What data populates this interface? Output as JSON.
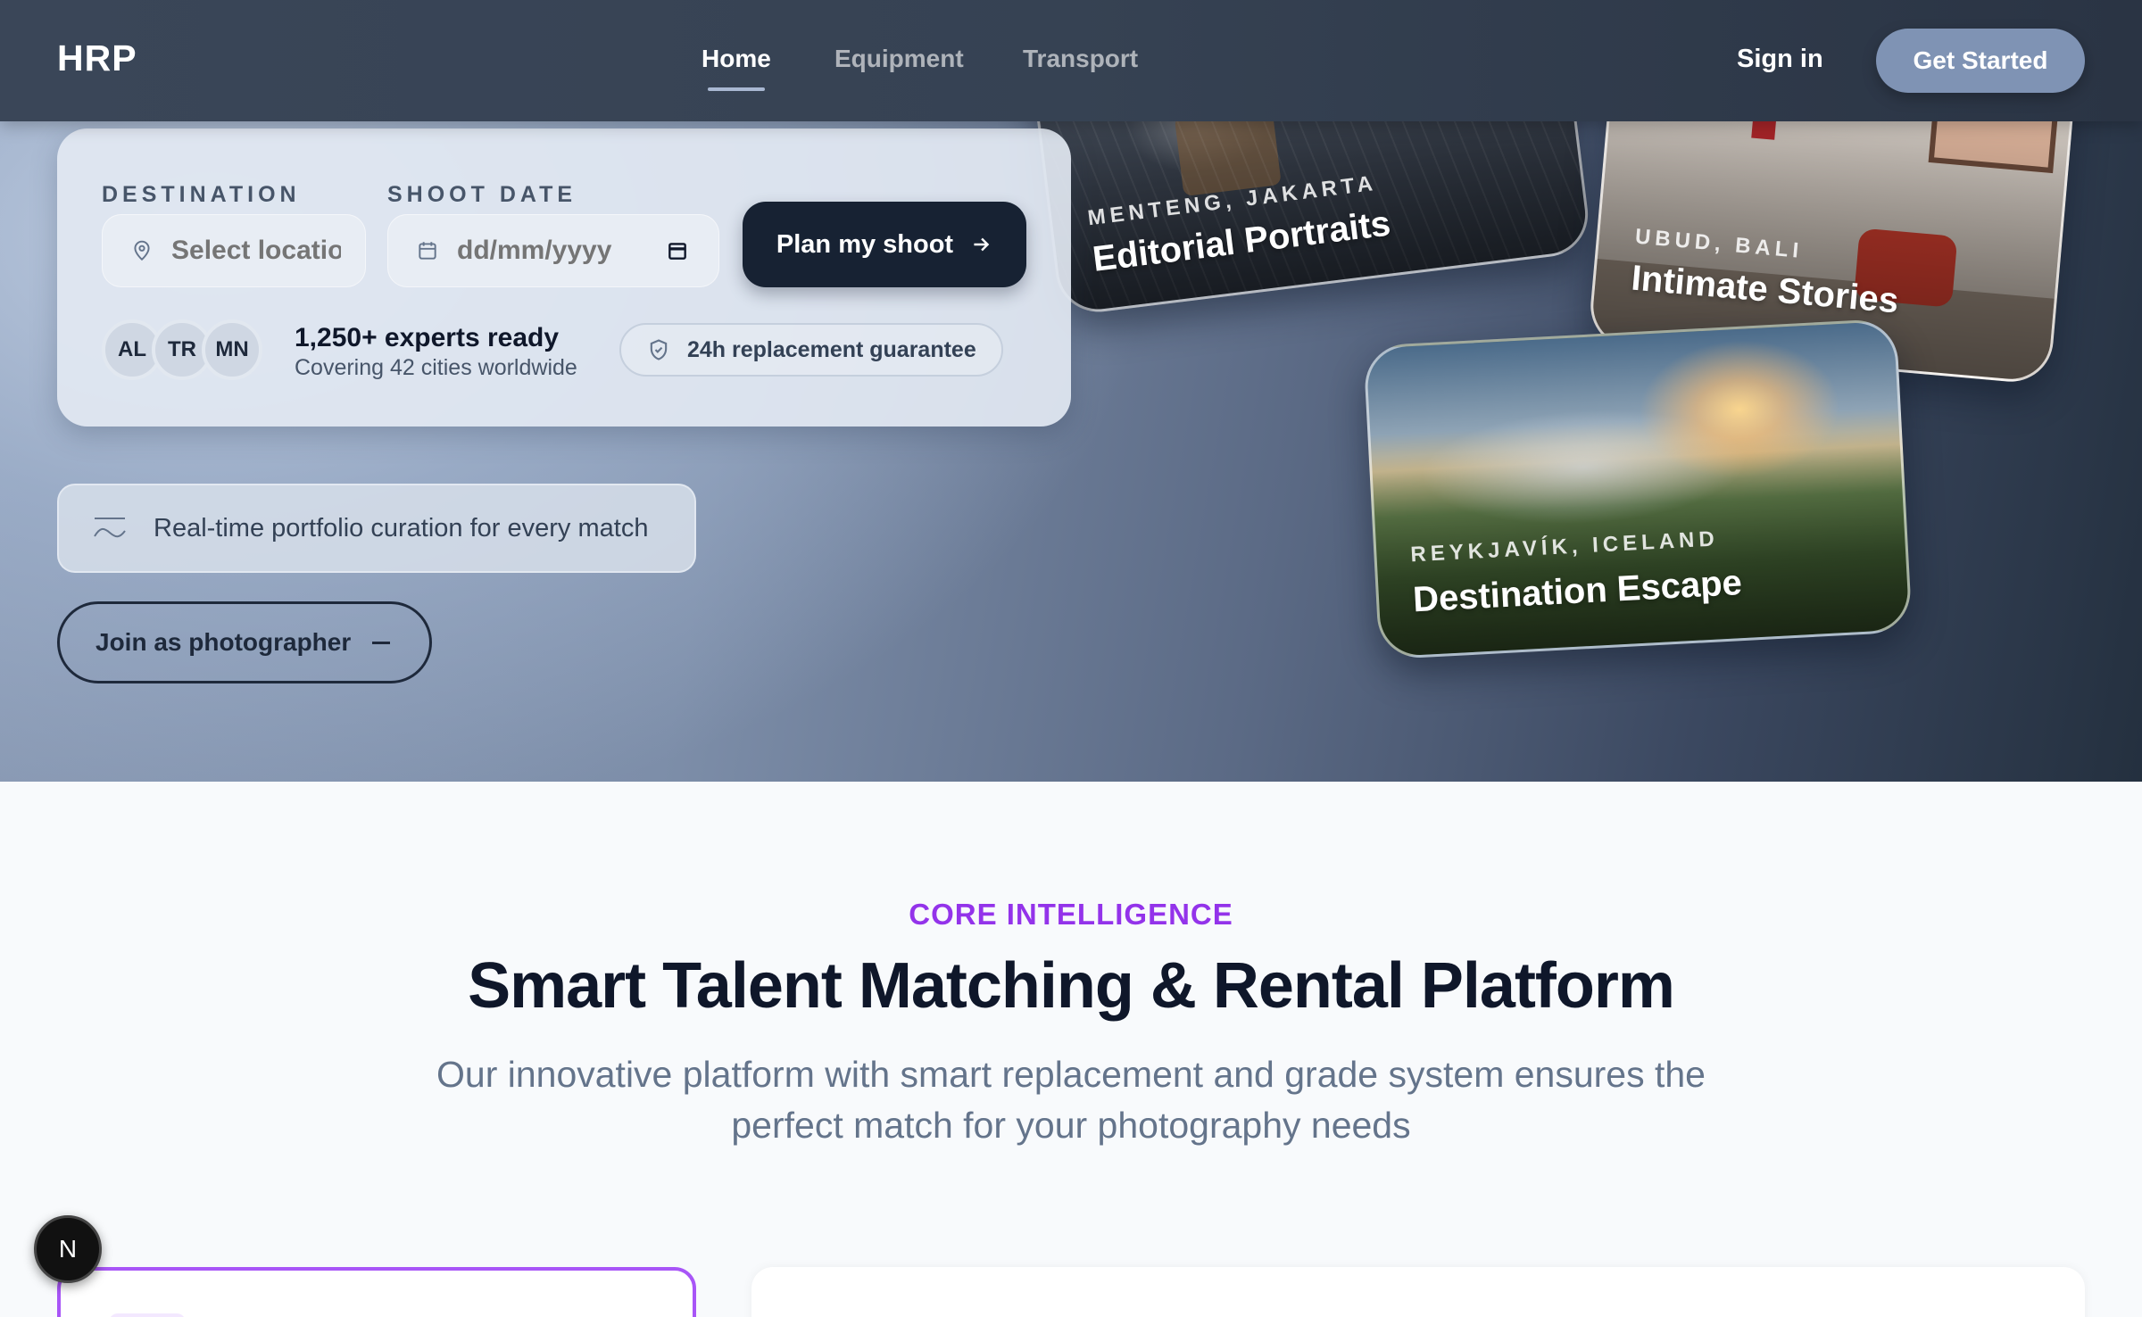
{
  "nav": {
    "brand": "HRP",
    "links": [
      "Home",
      "Equipment",
      "Transport"
    ],
    "active_link": "Home",
    "sign_in": "Sign in",
    "get_started": "Get Started"
  },
  "search": {
    "destination_label": "DESTINATION",
    "destination_placeholder": "Select location",
    "date_label": "SHOOT DATE",
    "date_placeholder": "dd/mm/yyyy",
    "plan_button": "Plan my shoot",
    "avatars": [
      "AL",
      "TR",
      "MN"
    ],
    "experts": "1,250+ experts ready",
    "covering": "Covering 42 cities worldwide",
    "guarantee": "24h replacement guarantee"
  },
  "curation": "Real-time portfolio curation for every match",
  "join_button": "Join as photographer",
  "cards": [
    {
      "location": "MENTENG, JAKARTA",
      "title": "Editorial Portraits"
    },
    {
      "location": "UBUD, BALI",
      "title": "Intimate Stories"
    },
    {
      "location": "REYKJAVÍK, ICELAND",
      "title": "Destination Escape"
    }
  ],
  "section": {
    "kicker": "CORE INTELLIGENCE",
    "title": "Smart Talent Matching & Rental Platform",
    "subtitle": "Our innovative platform with smart replacement and grade system ensures the perfect match for your photography needs"
  },
  "badge": "N",
  "colors": {
    "accent_purple": "#9333ea",
    "dark_navy": "#172233",
    "nav_button": "#7f93b4"
  },
  "icons": {
    "destination": "map-pin-icon",
    "date": "calendar-icon",
    "plan": "arrow-right-icon",
    "guarantee": "shield-check-icon",
    "curation": "wave-icon"
  }
}
